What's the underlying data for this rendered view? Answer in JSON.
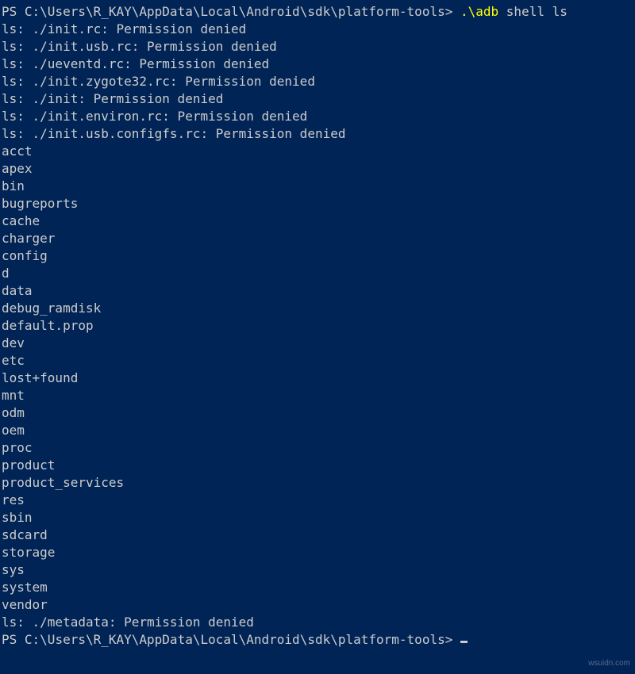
{
  "firstLine": {
    "promptPrefix": "PS ",
    "path": "C:\\Users\\R_KAY\\AppData\\Local\\Android\\sdk\\platform-tools",
    "promptSuffix": "> ",
    "exe": ".\\adb",
    "args": " shell ls"
  },
  "outputLines": [
    "ls: ./init.rc: Permission denied",
    "ls: ./init.usb.rc: Permission denied",
    "ls: ./ueventd.rc: Permission denied",
    "ls: ./init.zygote32.rc: Permission denied",
    "ls: ./init: Permission denied",
    "ls: ./init.environ.rc: Permission denied",
    "ls: ./init.usb.configfs.rc: Permission denied",
    "acct",
    "apex",
    "bin",
    "bugreports",
    "cache",
    "charger",
    "config",
    "d",
    "data",
    "debug_ramdisk",
    "default.prop",
    "dev",
    "etc",
    "lost+found",
    "mnt",
    "odm",
    "oem",
    "proc",
    "product",
    "product_services",
    "res",
    "sbin",
    "sdcard",
    "storage",
    "sys",
    "system",
    "vendor",
    "ls: ./metadata: Permission denied"
  ],
  "lastLine": {
    "promptPrefix": "PS ",
    "path": "C:\\Users\\R_KAY\\AppData\\Local\\Android\\sdk\\platform-tools",
    "promptSuffix": "> "
  },
  "watermark": "wsuidn.com"
}
